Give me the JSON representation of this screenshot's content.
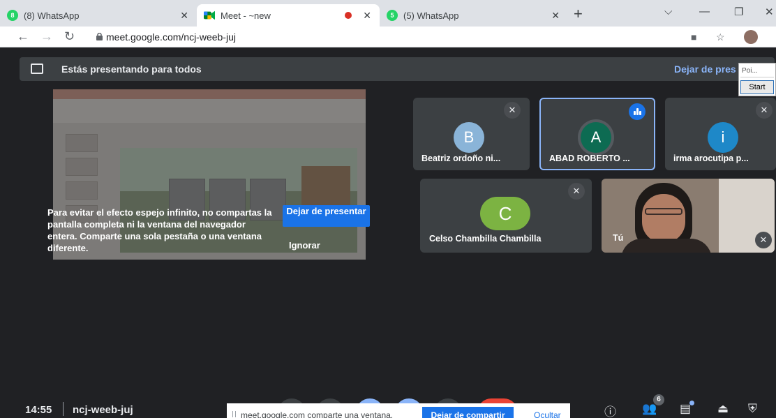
{
  "browser": {
    "tabs": [
      {
        "title": "(8) WhatsApp",
        "badge": "8"
      },
      {
        "title": "Meet - ~new"
      },
      {
        "title": "(5) WhatsApp",
        "badge": "5"
      }
    ],
    "url": "meet.google.com/ncj-weeb-juj"
  },
  "banner": {
    "text": "Estás presentando para todos",
    "stop": "Dejar de pres"
  },
  "mini_window": {
    "input": "Poi...",
    "start": "Start"
  },
  "warning": {
    "text": "Para evitar el efecto espejo infinito, no compartas la pantalla completa ni la ventana del navegador entera. Comparte una sola pestaña o una ventana diferente.",
    "stop_button": "Dejar de presentar",
    "ignore_button": "Ignorar"
  },
  "participants": [
    {
      "initial": "B",
      "name": "Beatriz ordoño ni...",
      "color": "#8ab4d8"
    },
    {
      "initial": "A",
      "name": "ABAD ROBERTO ...",
      "color": "#0d6b52"
    },
    {
      "initial": "i",
      "name": "irma arocutipa p...",
      "color": "#1e88c8"
    },
    {
      "initial": "C",
      "name": "Celso Chambilla Chambilla",
      "color": "#7cb342"
    },
    {
      "name": "Tú"
    }
  ],
  "footer": {
    "time": "14:55",
    "meeting_code": "ncj-weeb-juj",
    "participants_count": "6"
  },
  "share_bar": {
    "text": "meet.google.com comparte una ventana.",
    "stop": "Dejar de compartir",
    "hide": "Ocultar"
  }
}
